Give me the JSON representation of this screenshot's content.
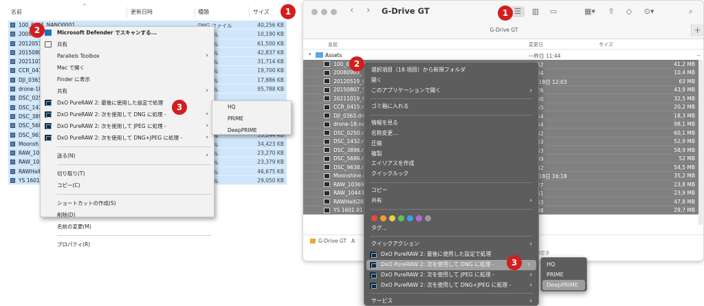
{
  "windows": {
    "headers": {
      "name": "名前",
      "date": "更新日時",
      "type": "種類",
      "size": "サイズ",
      "sort_arrow": "^"
    },
    "rows": [
      {
        "name": "100_0001_NANO0001",
        "type": "DNG ファイル",
        "size": "40,256 KB"
      },
      {
        "name": "2008",
        "type": "ファイル",
        "size": "10,190 KB"
      },
      {
        "name": "20120519",
        "type": "ファイル",
        "size": "61,500 KB"
      },
      {
        "name": "20150807",
        "type": "ファイル",
        "size": "42,837 KB"
      },
      {
        "name": "20211019",
        "type": "ファイル",
        "size": "31,714 KB"
      },
      {
        "name": "CCR_041",
        "type": "ファイル",
        "size": "19,700 KB"
      },
      {
        "name": "DJI_0363",
        "type": "ファイル",
        "size": "17,886 KB"
      },
      {
        "name": "drone-18",
        "type": "ファイル",
        "size": "95,788 KB"
      },
      {
        "name": "DSC_025",
        "type": "",
        "size": ""
      },
      {
        "name": "DSC_143",
        "type": "",
        "size": ""
      },
      {
        "name": "DSC_389",
        "type": "",
        "size": ""
      },
      {
        "name": "DSC_568",
        "type": "",
        "size": ""
      },
      {
        "name": "DSC_963",
        "type": "ファイル",
        "size": "53,244 KB"
      },
      {
        "name": "Moonsh",
        "type": "ファイル",
        "size": "34,423 KB"
      },
      {
        "name": "RAW_10",
        "type": "ファイル",
        "size": "23,270 KB"
      },
      {
        "name": "RAW_10",
        "type": "ファイル",
        "size": "23,379 KB"
      },
      {
        "name": "RAWHaiti",
        "type": "ファイル",
        "size": "46,675 KB"
      },
      {
        "name": "YS 1601 (",
        "type": "ファイル",
        "size": "29,050 KB"
      }
    ],
    "menu": {
      "defender": "Microsoft Defender でスキャンする...",
      "share": "共有",
      "parallels": "Parallels Toolbox",
      "open_mac": "Mac で開く",
      "finder_show": "Finder に表示",
      "share2": "共有",
      "dxo_last": "DxO PureRAW 2: 最後に使用した設定で処理",
      "dxo_dng": "DxO PureRAW 2: 次を使用して DNG に処理 -",
      "dxo_jpeg": "DxO PureRAW 2: 次を使用して JPEG に処理 -",
      "dxo_both": "DxO PureRAW 2: 次を使用して DNG+JPEG に処理 -",
      "send_to": "送る(N)",
      "cut": "切り取り(T)",
      "copy": "コピー(C)",
      "shortcut": "ショートカットの作成(S)",
      "delete": "削除(D)",
      "rename": "名前の変更(M)",
      "properties": "プロパティ(R)"
    },
    "submenu": [
      "HQ",
      "PRIME",
      "DeepPRIME"
    ]
  },
  "mac": {
    "title": "G-Drive GT",
    "tab_title": "G-Drive GT",
    "headers": {
      "name": "名前",
      "date": "変更日",
      "size": "サイズ"
    },
    "group": {
      "name": "Assets",
      "date": "一昨日 11:44",
      "size": "--"
    },
    "rows": [
      {
        "name": "100_0001_NANO0001.dng",
        "date": "日 10:52",
        "size": "41,2 MB"
      },
      {
        "name": "20080903_",
        "date": "日 11:44",
        "size": "10,4 MB"
      },
      {
        "name": "20120519_O",
        "date": "2年2月18日 12:03",
        "size": "63 MB"
      },
      {
        "name": "20150807_S",
        "date": "日 10:26",
        "size": "43,9 MB"
      },
      {
        "name": "20211019_O",
        "date": "日 11:40",
        "size": "32,5 MB"
      },
      {
        "name": "CCR_0415.n",
        "date": "日 10:55",
        "size": "20,2 MB"
      },
      {
        "name": "DJI_0363.dn",
        "date": "日 10:54",
        "size": "18,3 MB"
      },
      {
        "name": "drone-18.ne",
        "date": "日 11:44",
        "size": "98,1 MB"
      },
      {
        "name": "DSC_0250.n",
        "date": "日 11:42",
        "size": "60,1 MB"
      },
      {
        "name": "DSC_1432.n",
        "date": "日 11:43",
        "size": "52,9 MB"
      },
      {
        "name": "DSC_3896.n",
        "date": "日 11:43",
        "size": "58,9 MB"
      },
      {
        "name": "DSC_5686.n",
        "date": "日 11:39",
        "size": "52 MB"
      },
      {
        "name": "DSC_9638.n",
        "date": "日 11:42",
        "size": "54,5 MB"
      },
      {
        "name": "Moonshine.c",
        "date": "2年2月18日 16:18",
        "size": "35,2 MB"
      },
      {
        "name": "RAW_10369",
        "date": "日 10:27",
        "size": "23,8 MB"
      },
      {
        "name": "RAW_10443",
        "date": "日 11:41",
        "size": "23,9 MB"
      },
      {
        "name": "RAWHaiti28",
        "date": "日 11:43",
        "size": "47,8 MB"
      },
      {
        "name": "YS 1601 01 U",
        "date": "日 11:38",
        "size": "29,7 MB"
      }
    ],
    "path": [
      "G-Drive GT",
      "A"
    ],
    "status": "B空き",
    "menu": {
      "new_folder": "選択項目（18 項目）から新規フォルダ",
      "open": "開く",
      "open_with": "このアプリケーションで開く",
      "trash": "ゴミ箱に入れる",
      "info": "情報を見る",
      "rename": "名称変更...",
      "compress": "圧縮",
      "duplicate": "複製",
      "alias": "エイリアスを作成",
      "quicklook": "クイックルック",
      "copy": "コピー",
      "share": "共有",
      "tags": "タグ...",
      "quick_actions": "クイックアクション",
      "dxo_last": "DxO PureRAW 2: 最後に使用した設定で処理",
      "dxo_dng": "DxO PureRAW 2: 次を使用して DNG に処理 -",
      "dxo_jpeg": "DxO PureRAW 2: 次を使用して JPEG に処理 -",
      "dxo_both": "DxO PureRAW 2: 次を使用して DNG+JPEG に処理 -",
      "services": "サービス"
    },
    "tag_colors": [
      "#e8483e",
      "#f59c2f",
      "#f2cf3a",
      "#5cc35a",
      "#3e9ef0",
      "#b36ad6",
      "#9a9a9a"
    ],
    "submenu": [
      "HQ",
      "PRIME",
      "DeepPRIME"
    ]
  },
  "badges": {
    "one": "1",
    "two": "2",
    "three": "3"
  },
  "colors": {
    "badge": "#d21e1e",
    "win_selection": "#cfe6fb",
    "mac_selection": "#808080"
  }
}
